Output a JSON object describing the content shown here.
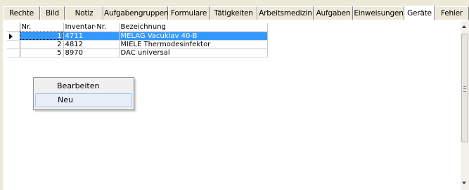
{
  "tabs": [
    {
      "label": "Rechte",
      "active": false
    },
    {
      "label": "Bild",
      "active": false
    },
    {
      "label": "Notiz",
      "active": false
    },
    {
      "label": "Aufgabengruppen",
      "active": false
    },
    {
      "label": "Formulare",
      "active": false
    },
    {
      "label": "Tätigkeiten",
      "active": false
    },
    {
      "label": "Arbeitsmedizin",
      "active": false
    },
    {
      "label": "Aufgaben",
      "active": false
    },
    {
      "label": "Einweisungen",
      "active": false
    },
    {
      "label": "Geräte",
      "active": true
    },
    {
      "label": "Fehler",
      "active": false
    }
  ],
  "grid": {
    "columns": [
      "Nr.",
      "Inventar-Nr.",
      "Bezeichnung"
    ],
    "rows": [
      {
        "nr": "1",
        "inventar": "4711",
        "bezeichnung": "MELAG Vacuklav 40-B",
        "selected": true
      },
      {
        "nr": "2",
        "inventar": "4812",
        "bezeichnung": "MIELE Thermodesinfektor",
        "selected": false
      },
      {
        "nr": "5",
        "inventar": "8970",
        "bezeichnung": "DAC universal",
        "selected": false
      }
    ]
  },
  "context_menu": {
    "items": [
      {
        "label": "Bearbeiten",
        "hover": false
      },
      {
        "label": "Neu",
        "hover": true
      }
    ]
  },
  "colors": {
    "selection": "#3399ff",
    "window_bg": "#ece9d8",
    "menu_hover": "#e8eff8"
  },
  "icons": {
    "row_pointer": "current-row-arrow-icon",
    "scroll_up": "scroll-up-arrow-icon",
    "scroll_down": "scroll-down-arrow-icon"
  }
}
